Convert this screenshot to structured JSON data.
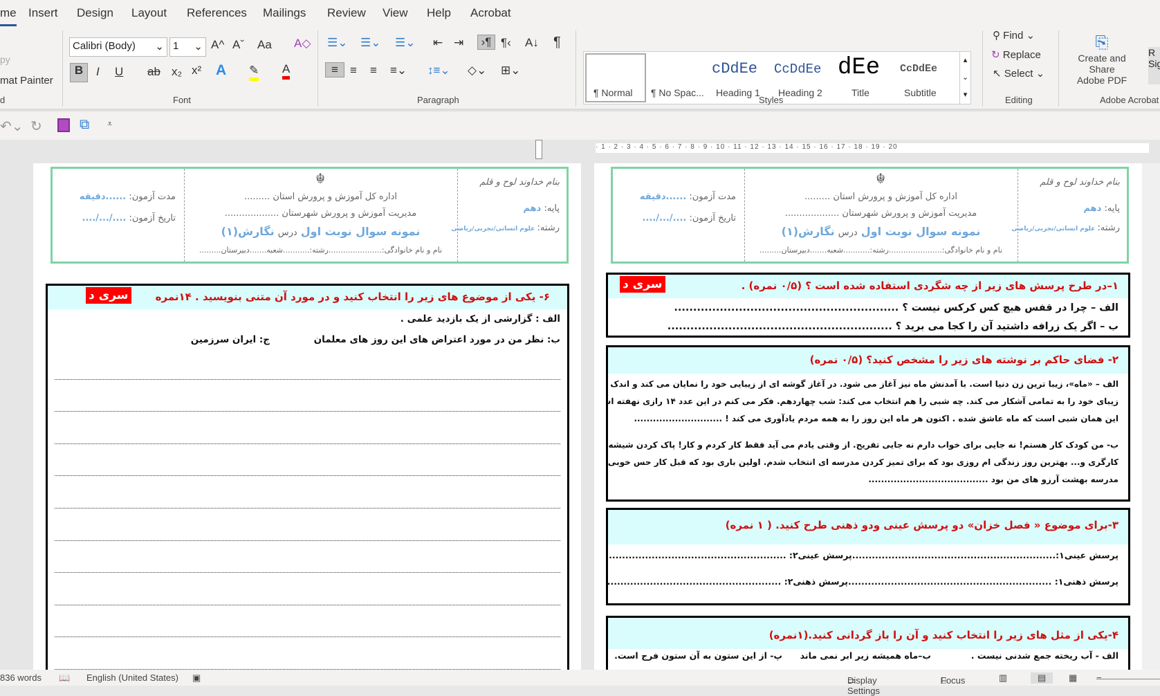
{
  "tabs": [
    "me",
    "Insert",
    "Design",
    "Layout",
    "References",
    "Mailings",
    "Review",
    "View",
    "Help",
    "Acrobat"
  ],
  "clipboard": {
    "copy_partial": "py",
    "format_painter": "mat Painter",
    "group_partial": "d"
  },
  "font": {
    "name": "Calibri (Body)",
    "size": "1",
    "group": "Font",
    "grow": "A^",
    "shrink": "Aˇ",
    "case": "Aa",
    "bold": "B",
    "italic": "I",
    "underline": "U",
    "strike": "ab",
    "sub": "x₂",
    "sup": "x²",
    "effects": "A",
    "highlight_color": "#ffff00",
    "font_color": "#e00000"
  },
  "paragraph": {
    "group": "Paragraph",
    "pilcrow": "¶"
  },
  "styles": {
    "group": "Styles",
    "items": [
      {
        "preview": "",
        "label": "¶ Normal"
      },
      {
        "preview": "",
        "label": "¶ No Spac..."
      },
      {
        "preview": "cDdEe",
        "label": "Heading 1"
      },
      {
        "preview": "CcDdEe",
        "label": "Heading 2"
      },
      {
        "preview": "dEe",
        "label": "Title"
      },
      {
        "preview": "CcDdEe",
        "label": "Subtitle"
      }
    ]
  },
  "editing": {
    "group": "Editing",
    "find": "Find",
    "replace": "Replace",
    "select": "Select"
  },
  "acrobat": {
    "group": "Adobe Acrobat",
    "create_line1": "Create and Share",
    "create_line2": "Adobe PDF",
    "partial": "R Sig"
  },
  "ruler": "· 1 · 2 · 3 · 4 · 5 · 6 · 7 · 8 · 9 · 10 · 11 · 12 · 13 · 14 · 15 · 16 · 17 · 18 · 19 · 20",
  "header": {
    "basmala": "بنام خداوند لوح و قلم",
    "grade_label": "پایه:",
    "grade": "دهم",
    "field_label": "رشته:",
    "field": "علوم انسانی/تجربی/ریاضی",
    "dept1": "اداره کل آموزش و پرورش استان .........",
    "dept2": "مدیریت آموزش و پرورش شهرستان ...................",
    "title_a": "نمونه سوال نوبت اول",
    "title_b": "درس",
    "title_c": "نگارش(۱)",
    "student": "نام و نام خانوادگی:......................رشته:...........شعبه.......دبیرستان.........",
    "duration_label": "مدت آزمون:",
    "duration": "......دقیقه",
    "date_label": "تاریخ آزمون:",
    "date": "..../.../....",
    "emblem": "emblem-icon"
  },
  "badge": "سری د",
  "left_q6": {
    "title": "۶-  یکی از موضوع های زیر را انتخاب کنید و در مورد آن متنی بنویسید . ۱۴نمره",
    "a": "الف : گزارشی از یک بازدید علمی .",
    "b": "ب: نظر من در مورد اعتراض های این روز های معلمان",
    "c": "ج: ایران سرزمین"
  },
  "q1": {
    "title": "۱–در طرح پرسش های زیر از چه شگردی استفاده شده است ؟ (۰/۵ نمره) .",
    "a": "الف – چرا در قفس هیچ کس کرکس نیست ؟ ...........................................................",
    "b": "ب – اگر یک زرافه داشتید آن را کجا می برید ؟ ..........................................................."
  },
  "q2": {
    "title": "۲- فضای حاکم بر نوشته های زیر را مشخص کنید؟ (۰/۵ نمره)",
    "a": [
      "الف – «ماه»، زیبا ترین زن دنیا است. با آمدنش ماه نیز آغاز می شود. در آغاز گوشه ای از زیبایی خود را نمایان می کند و اندک اندک چهره",
      "زیبای خود را به تمامی آشکار می کند. چه شبی را هم انتخاب می کند: شب چهاردهم. فکر می کنم در این عدد ۱۴ رازی نهفته است. شاید",
      "این همان شبی است که ماه عاشق شده . اکنون هر ماه این روز را به همه مردم یادآوری می کند ! ............................"
    ],
    "b": [
      "ب- من کودک کار هستم! نه جایی برای خواب دارم نه جایی تفریح. از وقتی یادم می آید فقط کار کردم و کار! پاک کردن شیشه ماشین ها،",
      "کارگری و... بهترین روز زندگی ام روزی بود که برای تمیز کردن مدرسه ای انتخاب شدم. اولین باری بود که قبل کار حس خوبی داشتم.",
      "مدرسه بهشت آرزو های من بود ......................................"
    ]
  },
  "q3": {
    "title": "۳-برای موضوع « فصل خزان» دو پرسش  عینی ودو ذهنی طرح کنید.   ( ۱ نمره)",
    "r1": "پرسش عینی۱:..............................................................پرسش عینی۲: ...........................................................",
    "r2": "پرسش ذهنی۱: ..............................................................پرسش ذهنی۲:  ..........................................................."
  },
  "q4": {
    "title": "۴-یکی از مثل های زیر را انتخاب کنید و آن را باز گردانی کنید.(۱نمره)",
    "a": "الف - آب ریخته جمع شدنی نیست .",
    "b": "ب–ماه همیشه زیر ابر نمی ماند",
    "c": "پ- از این ستون به آن ستون فرج است."
  },
  "status": {
    "words": "836 words",
    "language": "English (United States)",
    "display": "Display Settings",
    "focus": "Focus"
  }
}
